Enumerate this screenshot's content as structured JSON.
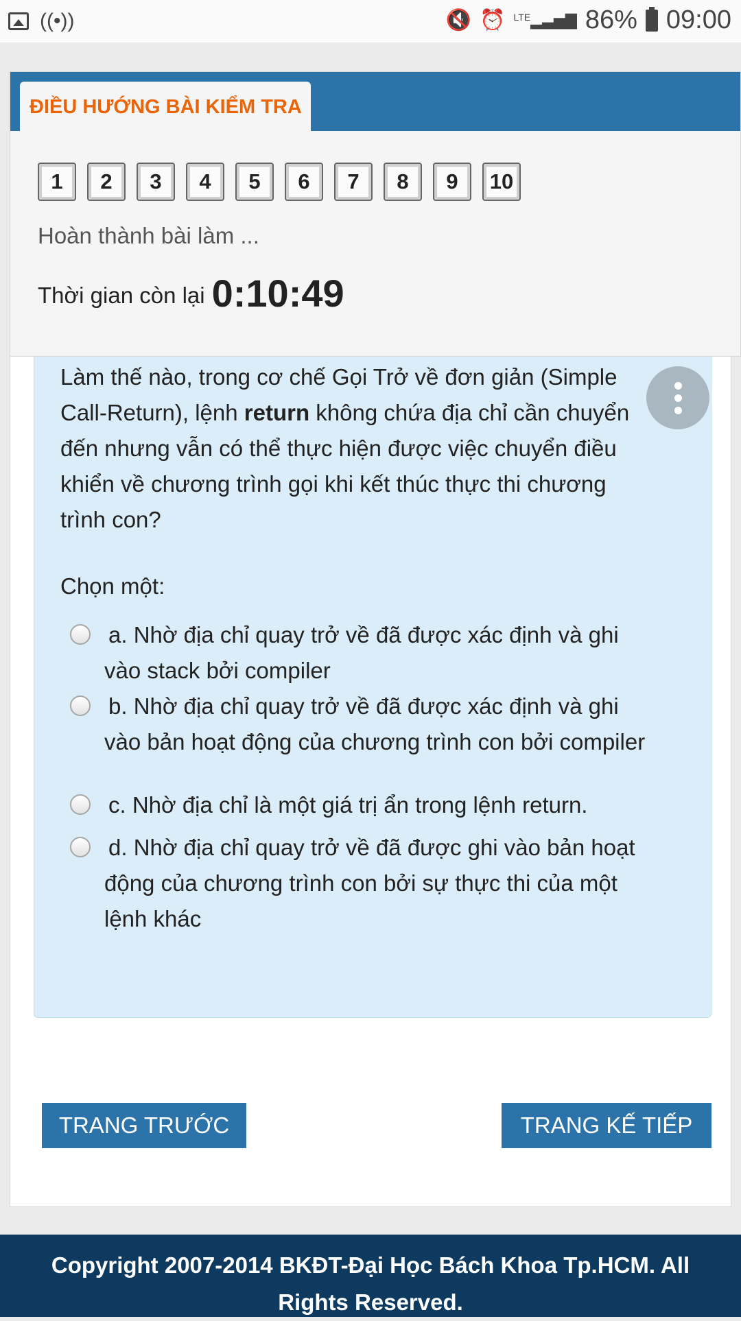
{
  "status_bar": {
    "battery": "86%",
    "time": "09:00",
    "network": "LTE"
  },
  "nav": {
    "header_title": "ĐIỀU HƯỚNG BÀI KIỂM TRA",
    "question_numbers": [
      "1",
      "2",
      "3",
      "4",
      "5",
      "6",
      "7",
      "8",
      "9",
      "10"
    ],
    "finish_link": "Hoàn thành bài làm ...",
    "timer_label": "Thời gian còn lại",
    "timer_value": "0:10:49"
  },
  "question": {
    "text_before": "Làm thế nào, trong cơ chế Gọi Trở về đơn giản (Simple Call-Return), lệnh ",
    "text_bold": "return",
    "text_after": " không chứa địa chỉ cần chuyển đến nhưng vẫn có thể thực hiện được việc chuyển điều khiển về chương trình gọi khi kết thúc thực thi chương trình con?",
    "choose_label": "Chọn một:",
    "options": [
      "a. Nhờ địa chỉ quay trở về đã được xác định và ghi vào stack bởi compiler",
      "b. Nhờ địa chỉ quay trở về đã được xác định và ghi vào bản hoạt động của chương trình con bởi compiler",
      "c. Nhờ địa chỉ là một giá trị ẩn trong lệnh return.",
      "d. Nhờ địa chỉ quay trở về đã được ghi vào bản hoạt động của chương trình con bởi sự thực thi của một lệnh khác"
    ]
  },
  "buttons": {
    "prev": "TRANG TRƯỚC",
    "next": "TRANG KẾ TIẾP"
  },
  "footer": {
    "copyright": "Copyright 2007-2014 BKĐT-Đại Học Bách Khoa Tp.HCM. All Rights Reserved."
  },
  "colors": {
    "primary_blue": "#2c73a9",
    "accent_orange": "#e8650a",
    "question_bg": "#dbedf8",
    "footer_bg": "#0d3a5e"
  }
}
